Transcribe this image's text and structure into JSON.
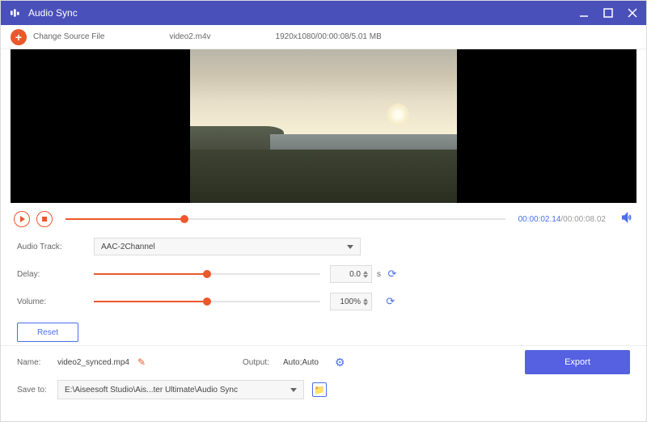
{
  "titlebar": {
    "title": "Audio Sync"
  },
  "infobar": {
    "change_label": "Change Source File",
    "filename": "video2.m4v",
    "specs": "1920x1080/00:00:08/5.01 MB"
  },
  "playback": {
    "current_time": "00:00:02.14",
    "total_time": "/00:00:08.02"
  },
  "controls": {
    "audio_track_label": "Audio Track:",
    "audio_track_value": "AAC-2Channel",
    "delay_label": "Delay:",
    "delay_value": "0.0",
    "delay_unit": "s",
    "volume_label": "Volume:",
    "volume_value": "100%",
    "reset_label": "Reset"
  },
  "footer": {
    "name_label": "Name:",
    "name_value": "video2_synced.mp4",
    "output_label": "Output:",
    "output_value": "Auto;Auto",
    "save_label": "Save to:",
    "save_path": "E:\\Aiseesoft Studio\\Ais...ter Ultimate\\Audio Sync",
    "export_label": "Export"
  }
}
